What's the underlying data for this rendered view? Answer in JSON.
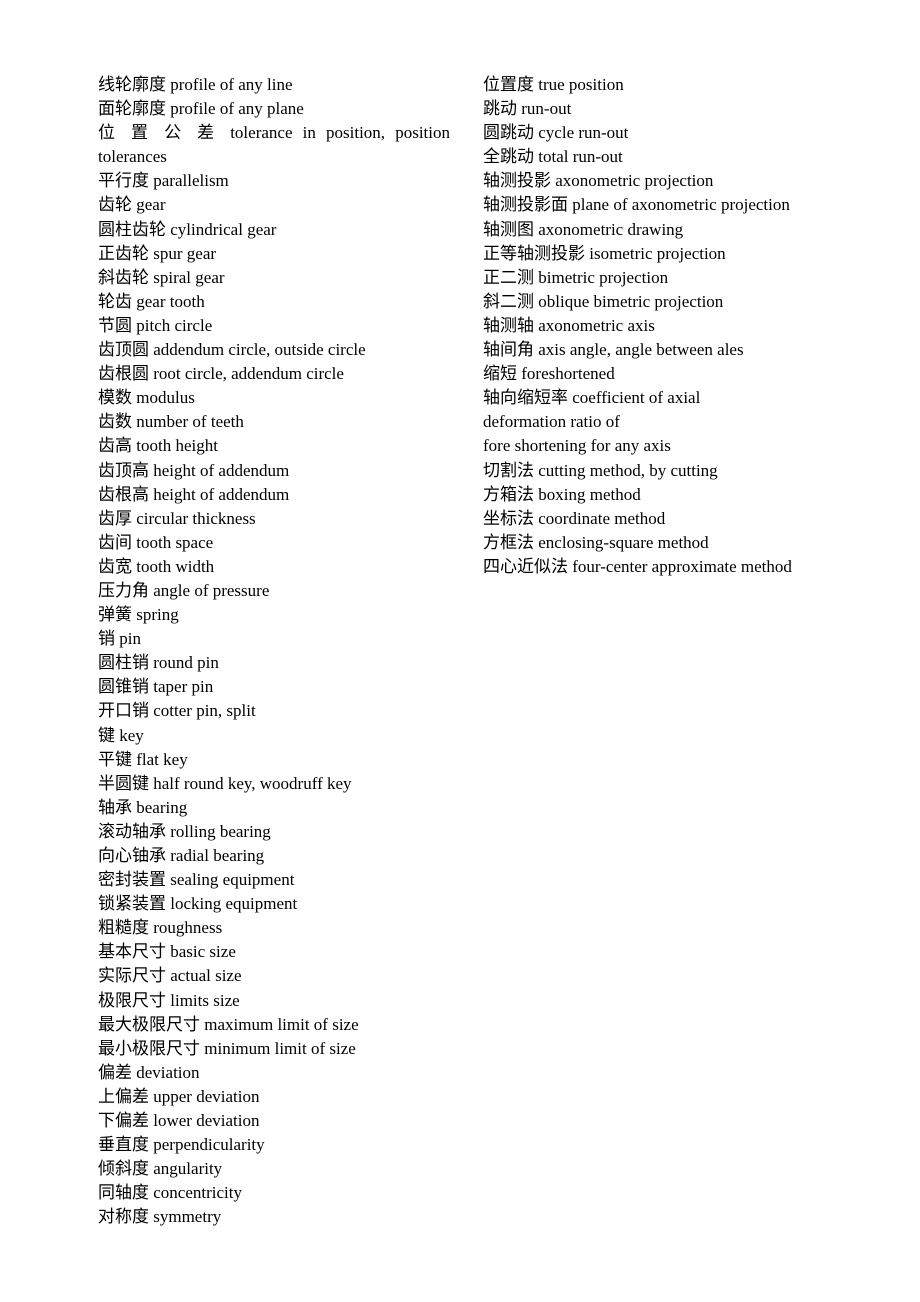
{
  "left_column": [
    "线轮廓度 profile of any line",
    "面轮廓度 profile of any plane",
    "位 置 公 差 tolerance in position, position",
    "tolerances",
    "平行度  parallelism",
    "齿轮 gear",
    "圆柱齿轮 cylindrical gear",
    "正齿轮 spur gear",
    "斜齿轮 spiral gear",
    "轮齿 gear tooth",
    "节圆 pitch circle",
    "齿顶圆 addendum circle, outside circle",
    "齿根圆 root circle, addendum circle",
    "模数 modulus",
    "齿数 number of teeth",
    "齿高 tooth height",
    "齿顶高 height of addendum",
    "齿根高 height of addendum",
    "齿厚 circular thickness",
    "齿间 tooth space",
    "齿宽 tooth width",
    "压力角 angle of pressure",
    "弹簧 spring",
    "销 pin",
    "圆柱销 round pin",
    "圆锥销 taper pin",
    "开口销 cotter pin, split",
    "键 key",
    "平键 flat key",
    "半圆键 half round key, woodruff key",
    "轴承 bearing",
    "滚动轴承 rolling bearing",
    "向心铀承 radial bearing",
    "密封装置 sealing equipment",
    "锁紧装置 locking equipment",
    "粗糙度 roughness",
    "基本尺寸 basic size",
    "实际尺寸 actual size",
    "极限尺寸 limits size",
    "最大极限尺寸 maximum limit of size",
    "最小极限尺寸 minimum limit of size",
    "偏差 deviation",
    "上偏差 upper deviation",
    "下偏差 lower deviation",
    "垂直度 perpendicularity",
    "倾斜度 angularity",
    "同轴度 concentricity",
    "对称度 symmetry"
  ],
  "right_column": [
    "位置度 true position",
    "跳动 run-out",
    "圆跳动 cycle run-out",
    "全跳动 total run-out",
    "轴测投影 axonometric projection",
    "轴测投影面 plane of axonometric projection",
    "轴测图 axonometric drawing",
    "正等轴测投影 isometric projection",
    "正二测 bimetric projection",
    "斜二测 oblique bimetric projection",
    "轴测轴 axonometric axis",
    "轴间角 axis angle, angle between ales",
    "缩短 foreshortened",
    "轴向缩短率 coefficient of axial",
    "deformation ratio of",
    "fore shortening for any axis",
    "切割法 cutting method, by cutting",
    "方箱法 boxing method",
    "坐标法 coordinate method",
    "方框法 enclosing-square method",
    "四心近似法 four-center approximate method"
  ]
}
